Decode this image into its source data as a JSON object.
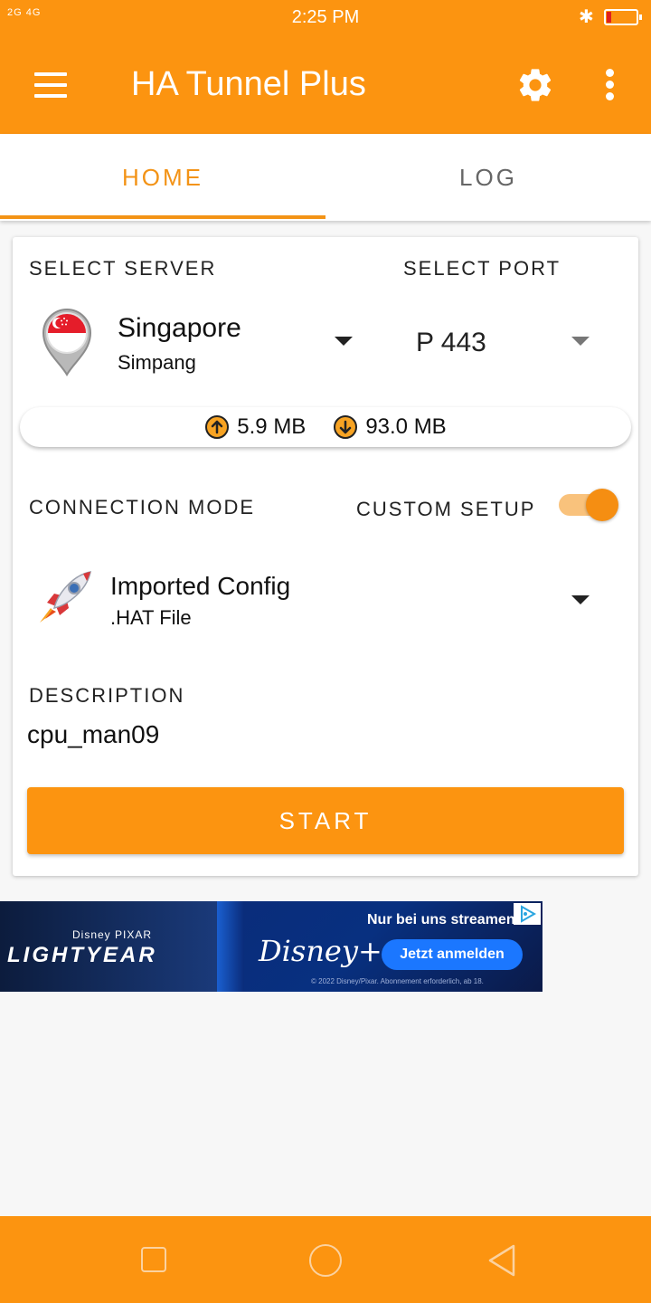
{
  "status_bar": {
    "signal": "2G  4G",
    "time": "2:25 PM"
  },
  "app_bar": {
    "title": "HA Tunnel Plus"
  },
  "tabs": [
    {
      "label": "HOME"
    },
    {
      "label": "LOG"
    }
  ],
  "server": {
    "section_label": "SELECT SERVER",
    "name": "Singapore",
    "location": "Simpang"
  },
  "port": {
    "section_label": "SELECT PORT",
    "value": "P 443"
  },
  "traffic": {
    "upload": "5.9 MB",
    "download": "93.0 MB"
  },
  "connection": {
    "section_label": "CONNECTION MODE",
    "custom_setup_label": "CUSTOM SETUP",
    "custom_setup_enabled": true,
    "mode_name": "Imported Config",
    "mode_sub": ".HAT File"
  },
  "description": {
    "section_label": "DESCRIPTION",
    "value": "cpu_man09"
  },
  "start_button": {
    "label": "START"
  },
  "ad": {
    "left_small": "Disney PIXAR",
    "left_big": "LIGHTYEAR",
    "brand": "Disney+",
    "tagline": "Nur bei uns streamen",
    "cta": "Jetzt anmelden",
    "legal": "© 2022 Disney/Pixar. Abonnement erforderlich, ab 18."
  },
  "colors": {
    "accent": "#fc9410",
    "tab_active": "#f39316"
  }
}
